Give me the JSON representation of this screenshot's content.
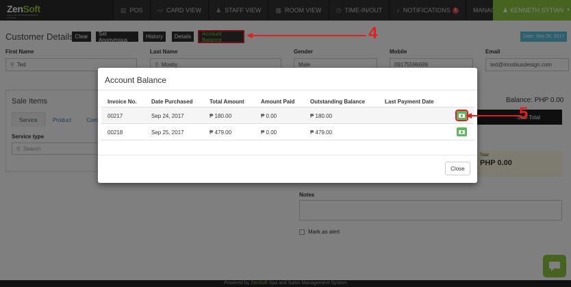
{
  "navbar": {
    "logo_zen": "Zen",
    "logo_soft": "Soft",
    "logo_tagline": "SPA & SALON MANAGEMENT SYSTEM",
    "items": [
      {
        "label": "POS",
        "icon": "pos-icon"
      },
      {
        "label": "CARD VIEW",
        "icon": "card-icon"
      },
      {
        "label": "STAFF VIEW",
        "icon": "staff-icon"
      },
      {
        "label": "ROOM VIEW",
        "icon": "room-icon"
      },
      {
        "label": "TIME-IN/OUT",
        "icon": "clock-icon"
      },
      {
        "label": "NOTIFICATIONS",
        "icon": "bell-icon",
        "badge": "1"
      },
      {
        "label": "MANAGE",
        "icon": "",
        "dropdown": true
      }
    ],
    "user": "KENNETH SYTIAN"
  },
  "customer": {
    "title": "Customer Details",
    "buttons": {
      "clear": "Clear",
      "set_anonymous": "Set Anonymous",
      "history": "History",
      "details": "Details",
      "account_balance": "Account Balance"
    },
    "date": "Date: Sep 28, 2017",
    "fields": {
      "first_name_label": "First Name",
      "first_name": "Ted",
      "last_name_label": "Last Name",
      "last_name": "Mosby",
      "gender_label": "Gender",
      "gender": "Male",
      "mobile_label": "Mobile",
      "mobile": "09175596699",
      "email_label": "Email",
      "email": "ted@mosbiusdesign.com"
    }
  },
  "sale_items": {
    "title": "Sale Items",
    "tabs": [
      "Service",
      "Product",
      "Com"
    ],
    "service_type_label": "Service type",
    "search_placeholder": "Search"
  },
  "right_panel": {
    "balance": "Balance: PHP 0.00",
    "subtotal_label": "Sub-Total",
    "total_label": "Total",
    "total_value": "PHP 0.00",
    "notes_label": "Notes",
    "mark_alert_label": "Mark as alert"
  },
  "modal": {
    "title": "Account Balance",
    "columns": [
      "Invoice No.",
      "Date Purchased",
      "Total Amount",
      "Amount Paid",
      "Outstanding Balance",
      "Last Payment Date"
    ],
    "rows": [
      {
        "invoice": "00217",
        "date": "Sep 24, 2017",
        "total": "₱ 180.00",
        "paid": "₱ 0.00",
        "outstanding": "₱ 180.00",
        "last_payment": ""
      },
      {
        "invoice": "00218",
        "date": "Sep 25, 2017",
        "total": "₱ 479.00",
        "paid": "₱ 0.00",
        "outstanding": "₱ 479.00",
        "last_payment": ""
      }
    ],
    "close_label": "Close"
  },
  "annotations": {
    "step4": "4",
    "step5": "5"
  },
  "footer": {
    "prefix": "Powered by ",
    "brand": "ZenSoft",
    "suffix": " Spa and Salon Management System"
  },
  "colors": {
    "accent": "#8cc63f",
    "navbar": "#2b2b2b",
    "highlight": "#e02020",
    "info": "#5bc0de",
    "success": "#5cb85c"
  }
}
